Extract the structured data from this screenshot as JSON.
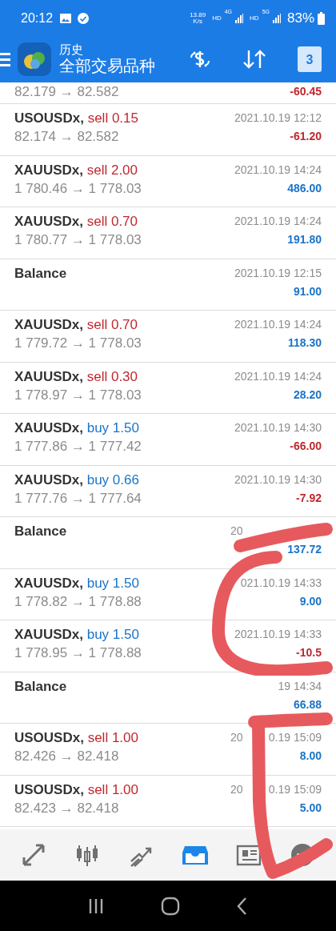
{
  "status_bar": {
    "time": "20:12",
    "net_speed_value": "13.89",
    "net_speed_unit": "K/s",
    "signals": [
      {
        "label": "HD",
        "network": "4G"
      },
      {
        "label": "HD",
        "network": "5G"
      }
    ],
    "battery": "83%"
  },
  "header": {
    "title": "历史",
    "subtitle": "全部交易品种",
    "calendar_day": "3"
  },
  "deals": [
    {
      "kind": "partial",
      "prices": "82.179 → 82.582",
      "profit": "-60.45",
      "color": "#c0282d"
    },
    {
      "kind": "sell",
      "symbol": "USOUSDx,",
      "type": "sell",
      "volume": "0.15",
      "prices": "82.174 → 82.582",
      "time": {
        "end": "2021.10.19 12:12"
      },
      "profit": "-61.20",
      "color": "#c0282d"
    },
    {
      "kind": "sell",
      "symbol": "XAUUSDx,",
      "type": "sell",
      "volume": "2.00",
      "prices": "1 780.46 → 1 778.03",
      "time": {
        "end": "2021.10.19 14:24"
      },
      "profit": "486.00",
      "color": "#1a73c9"
    },
    {
      "kind": "sell",
      "symbol": "XAUUSDx,",
      "type": "sell",
      "volume": "0.70",
      "prices": "1 780.77 → 1 778.03",
      "time": {
        "end": "2021.10.19 14:24"
      },
      "profit": "191.80",
      "color": "#1a73c9"
    },
    {
      "kind": "balance",
      "symbol": "Balance",
      "time": {
        "end": "2021.10.19 12:15"
      },
      "profit": "91.00",
      "color": "#1a73c9"
    },
    {
      "kind": "sell",
      "symbol": "XAUUSDx,",
      "type": "sell",
      "volume": "0.70",
      "prices": "1 779.72 → 1 778.03",
      "time": {
        "end": "2021.10.19 14:24"
      },
      "profit": "118.30",
      "color": "#1a73c9"
    },
    {
      "kind": "sell",
      "symbol": "XAUUSDx,",
      "type": "sell",
      "volume": "0.30",
      "prices": "1 778.97 → 1 778.03",
      "time": {
        "end": "2021.10.19 14:24"
      },
      "profit": "28.20",
      "color": "#1a73c9"
    },
    {
      "kind": "buy",
      "symbol": "XAUUSDx,",
      "type": "buy",
      "volume": "1.50",
      "prices": "1 777.86 → 1 777.42",
      "time": {
        "end": "2021.10.19 14:30"
      },
      "profit": "-66.00",
      "color": "#c0282d"
    },
    {
      "kind": "buy",
      "symbol": "XAUUSDx,",
      "type": "buy",
      "volume": "0.66",
      "prices": "1 777.76 → 1 777.64",
      "time": {
        "end": "2021.10.19 14:30"
      },
      "profit": "-7.92",
      "color": "#c0282d"
    },
    {
      "kind": "balance",
      "symbol": "Balance",
      "time": {
        "start": "20"
      },
      "profit": "137.72",
      "color": "#1a73c9"
    },
    {
      "kind": "buy",
      "symbol": "XAUUSDx,",
      "type": "buy",
      "volume": "1.50",
      "prices": "1 778.82 → 1 778.88",
      "time": {
        "end": "021.10.19 14:33"
      },
      "profit": "9.00",
      "color": "#1a73c9"
    },
    {
      "kind": "buy",
      "symbol": "XAUUSDx,",
      "type": "buy",
      "volume": "1.50",
      "prices": "1 778.95 → 1 778.88",
      "time": {
        "end": "2021.10.19 14:33"
      },
      "profit": "-10.5",
      "color": "#c0282d"
    },
    {
      "kind": "balance",
      "symbol": "Balance",
      "time": {
        "end": "19 14:34"
      },
      "profit": "66.88",
      "color": "#1a73c9"
    },
    {
      "kind": "sell",
      "symbol": "USOUSDx,",
      "type": "sell",
      "volume": "1.00",
      "prices": "82.426 → 82.418",
      "time": {
        "start": "20",
        "end": "0.19 15:09"
      },
      "profit": "8.00",
      "color": "#1a73c9"
    },
    {
      "kind": "sell",
      "symbol": "USOUSDx,",
      "type": "sell",
      "volume": "1.00",
      "prices": "82.423 → 82.418",
      "time": {
        "start": "20",
        "end": "0.19 15:09"
      },
      "profit": "5.00",
      "color": "#1a73c9"
    }
  ],
  "bottom_nav": [
    {
      "kind": "trade",
      "selected": false
    },
    {
      "kind": "chart",
      "selected": false
    },
    {
      "kind": "trend",
      "selected": false
    },
    {
      "kind": "history",
      "selected": true
    },
    {
      "kind": "news",
      "selected": false
    },
    {
      "kind": "chat",
      "selected": false
    }
  ]
}
